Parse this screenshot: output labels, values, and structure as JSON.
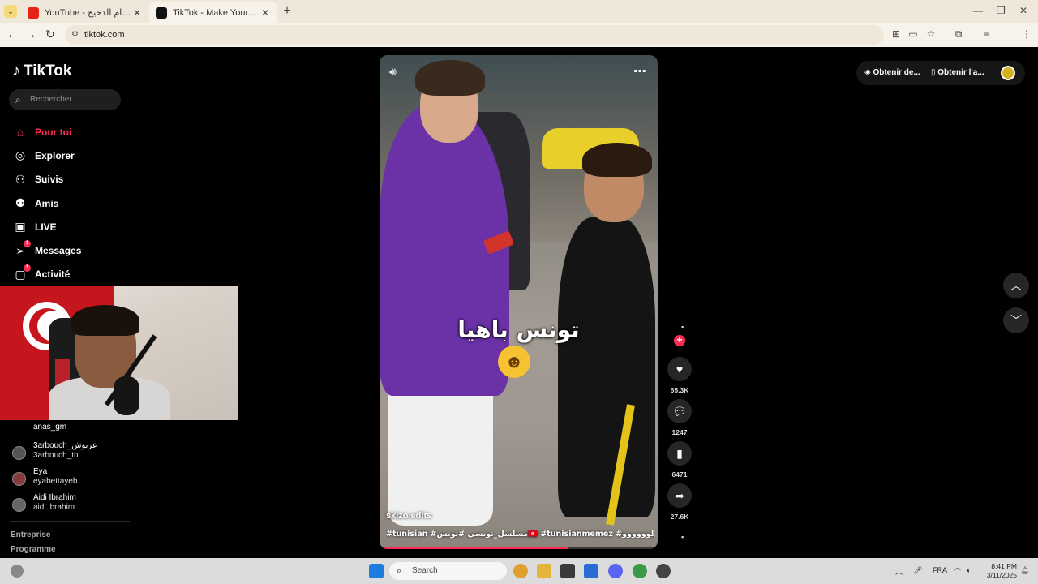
{
  "browser": {
    "tabs": [
      {
        "title": "YouTube - تاريخ الإعدام الدحيح",
        "active": false,
        "favicon_color": "#e62117"
      },
      {
        "title": "TikTok - Make Your Day",
        "active": true,
        "favicon_color": "#111111"
      }
    ],
    "new_tab": "+",
    "url": "tiktok.com",
    "profile_initial": "K"
  },
  "sidebar": {
    "logo": "TikTok",
    "search_placeholder": "Rechercher",
    "nav": [
      {
        "label": "Pour toi",
        "icon": "home-icon",
        "active": true
      },
      {
        "label": "Explorer",
        "icon": "compass-icon",
        "active": false
      },
      {
        "label": "Suivis",
        "icon": "following-icon",
        "active": false
      },
      {
        "label": "Amis",
        "icon": "friends-icon",
        "active": false
      },
      {
        "label": "LIVE",
        "icon": "live-icon",
        "active": false
      },
      {
        "label": "Messages",
        "icon": "messages-icon",
        "active": false,
        "badge": "1"
      },
      {
        "label": "Activité",
        "icon": "activity-icon",
        "active": false,
        "badge": "1"
      }
    ],
    "following": [
      {
        "name": "anas_gm",
        "handle": ""
      },
      {
        "name": "3arbouch_عربوش",
        "handle": "3arbouch_tn"
      },
      {
        "name": "Eya",
        "handle": "eyabettayeb"
      },
      {
        "name": "Aidi Ibrahim",
        "handle": "aidi.ibrahim"
      }
    ],
    "footer_links": [
      "Entreprise",
      "Programme"
    ]
  },
  "video": {
    "caption_overlay": "تونس باهيا",
    "author": "skizo.edits",
    "hashtags": "#tunisian #مسلسل_تونسي #تونس🇹🇳 #tunisianmemez #اكسيلوووووو",
    "progress": 0.68
  },
  "actions": {
    "likes": "65.3K",
    "comments": "1247",
    "saves": "6471",
    "shares": "27.6K"
  },
  "top_right": {
    "btn1": "Obtenir de...",
    "btn2": "Obtenir l'a..."
  },
  "taskbar": {
    "search_placeholder": "Search",
    "lang": "FRA",
    "time": "8:41 PM",
    "date": "3/11/2025"
  }
}
